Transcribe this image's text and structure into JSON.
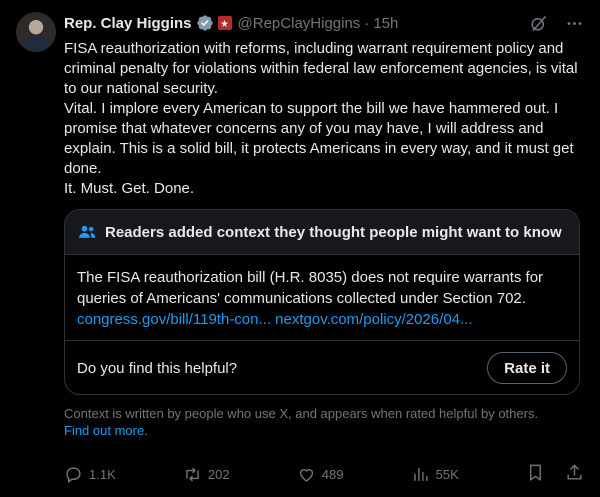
{
  "author": {
    "name": "Rep. Clay Higgins",
    "handle": "@RepClayHiggins",
    "separator": "·",
    "time": "15h"
  },
  "tweet": {
    "text": "FISA reauthorization with reforms, including warrant requirement policy and criminal penalty for violations within federal law enforcement agencies, is vital to our national security.\nVital. I implore every American to support the bill we have hammered out. I promise that whatever concerns any of you may have, I will address and explain. This is a solid bill, it protects Americans in every way, and it must get done.\n It. Must. Get. Done."
  },
  "community_note": {
    "title": "Readers added context they thought people might want to know",
    "body": "The FISA reauthorization bill (H.R. 8035) does not require warrants for queries of Americans' communications collected under Section 702.",
    "link1": "congress.gov/bill/119th-con...",
    "link2": "nextgov.com/policy/2026/04...",
    "helpful_question": "Do you find this helpful?",
    "rate_label": "Rate it"
  },
  "context_footer": {
    "text": "Context is written by people who use X, and appears when rated helpful by others.",
    "link": "Find out more."
  },
  "actions": {
    "replies": "1.1K",
    "reposts": "202",
    "likes": "489",
    "views": "55K"
  },
  "colors": {
    "background": "#000000",
    "text": "#e7e9ea",
    "muted": "#71767b",
    "link": "#1d9bf0",
    "border": "#2f3336"
  }
}
